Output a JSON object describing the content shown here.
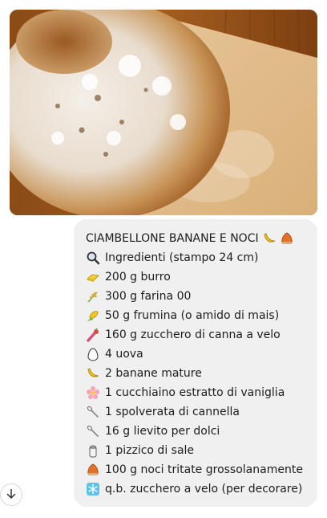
{
  "recipe": {
    "title": "CIAMBELLONE BANANE E NOCI",
    "title_icons": [
      "banana-icon",
      "chestnut-icon"
    ],
    "items": [
      {
        "icon": "magnifier-icon",
        "text": "Ingredienti (stampo 24 cm)"
      },
      {
        "icon": "butter-icon",
        "text": "200 g burro"
      },
      {
        "icon": "wheat-icon",
        "text": "300 g farina 00"
      },
      {
        "icon": "corn-icon",
        "text": "50 g frumina (o amido di mais)"
      },
      {
        "icon": "sugar-cane-icon",
        "text": "160 g zucchero di canna a velo"
      },
      {
        "icon": "egg-icon",
        "text": "4 uova"
      },
      {
        "icon": "banana-icon",
        "text": "2 banane mature"
      },
      {
        "icon": "flower-icon",
        "text": "1 cucchiaino estratto di vaniglia"
      },
      {
        "icon": "spoon-icon",
        "text": "1 spolverata di cannella"
      },
      {
        "icon": "spoon-icon",
        "text": "16 g lievito per dolci"
      },
      {
        "icon": "salt-shaker-icon",
        "text": "1 pizzico di sale"
      },
      {
        "icon": "chestnut-icon",
        "text": "100 g noci tritate grossolanamente"
      },
      {
        "icon": "snowflake-icon",
        "text": "q.b. zucchero a velo (per decorare)"
      }
    ]
  },
  "scroll_button": {
    "icon": "arrow-down-icon"
  },
  "colors": {
    "bubble_bg": "#f0f0f0",
    "text": "#1c1c1c"
  }
}
